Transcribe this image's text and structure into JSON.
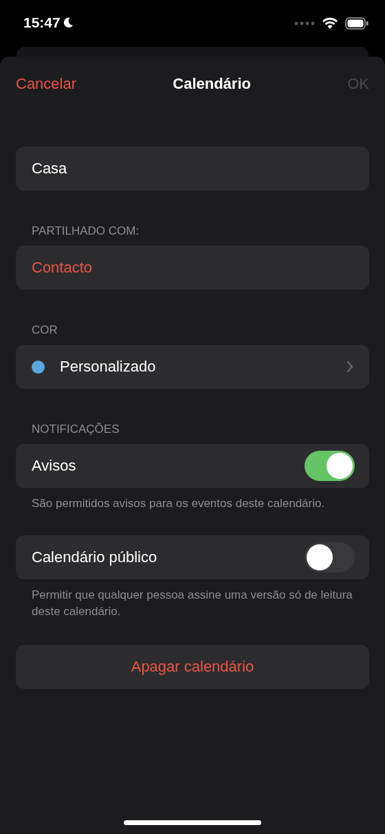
{
  "status_bar": {
    "time": "15:47"
  },
  "nav": {
    "cancel": "Cancelar",
    "title": "Calendário",
    "done": "OK",
    "done_disabled": true
  },
  "name_field": {
    "value": "Casa"
  },
  "sections": [
    {
      "header": "PARTILHADO COM:",
      "rows": [
        {
          "kind": "link",
          "label": "Contacto"
        }
      ]
    },
    {
      "header": "COR",
      "rows": [
        {
          "kind": "color",
          "label": "Personalizado",
          "color": "#5aa7de"
        }
      ]
    },
    {
      "header": "NOTIFICAÇÕES",
      "rows": [
        {
          "kind": "toggle",
          "label": "Avisos",
          "on": true
        }
      ],
      "footer": "São permitidos avisos para os eventos deste calendário."
    },
    {
      "rows": [
        {
          "kind": "toggle",
          "label": "Calendário público",
          "on": false
        }
      ],
      "footer": "Permitir que qualquer pessoa assine uma versão só de leitura deste calendário."
    }
  ],
  "delete_button": {
    "label": "Apagar calendário"
  }
}
